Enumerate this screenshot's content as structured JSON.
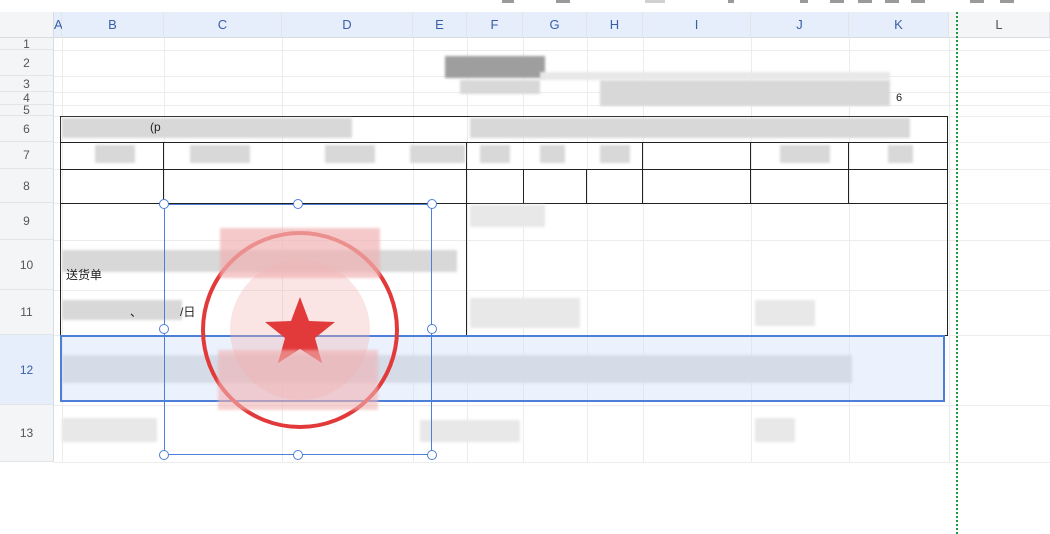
{
  "columns": [
    "A",
    "B",
    "C",
    "D",
    "E",
    "F",
    "G",
    "H",
    "I",
    "J",
    "K",
    "L"
  ],
  "rows": [
    "1",
    "2",
    "3",
    "4",
    "5",
    "6",
    "7",
    "8",
    "9",
    "10",
    "11",
    "12",
    "13"
  ],
  "selected_row": "12",
  "cell_text": {
    "k4_fragment": "6",
    "b10_fragment": "送货单",
    "b11_fragment": "、",
    "c11_fragment": "/日",
    "b6_fragment": "(p"
  },
  "colors": {
    "selection": "#4d7fd6",
    "page_break": "#1a9a3a",
    "stamp": "#e23a3a"
  },
  "icons": [
    "red-seal-stamp-icon"
  ]
}
